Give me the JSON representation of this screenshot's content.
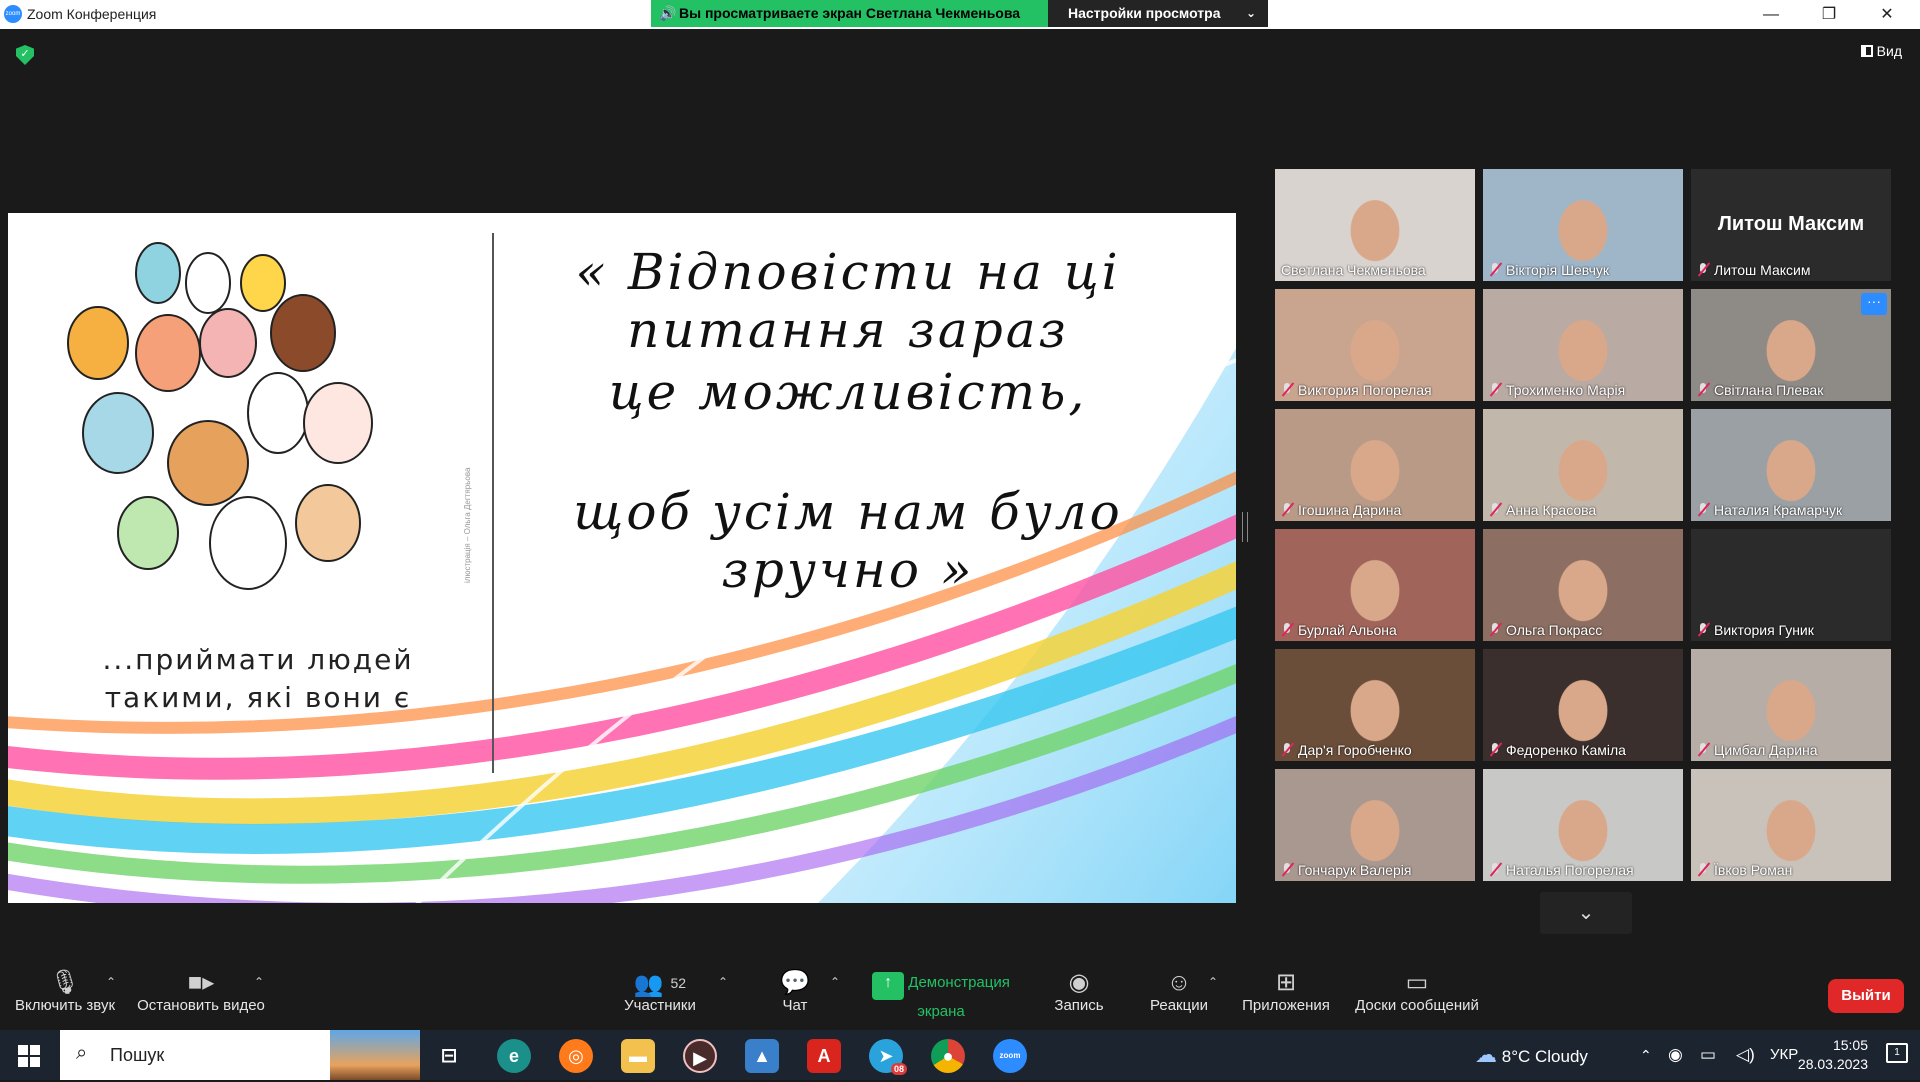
{
  "titlebar": {
    "app_title": "Zoom Конференция",
    "share_banner": "Вы просматриваете экран Светлана Чекменьова",
    "view_settings": "Настройки просмотра",
    "minimize": "—",
    "restore": "❐",
    "close": "✕"
  },
  "main": {
    "view_label": "Вид"
  },
  "slide": {
    "quote_line1": "« Відповісти на ці питання зараз",
    "quote_line2": "це можливість,",
    "quote_line3": "щоб усім нам було зручно »",
    "caption_line1": "...приймати людей",
    "caption_line2": "такими, які вони є",
    "illustrator": "ілюстрація – Ольга Дегтярьова"
  },
  "gallery": {
    "tiles": [
      {
        "name": "Светлана Чекменьова",
        "muted": false,
        "active": true,
        "photo_color": "#d9d3cf"
      },
      {
        "name": "Вікторія Шевчук",
        "muted": true,
        "photo_color": "#9fb6c9"
      },
      {
        "name": "Литош Максим",
        "muted": true,
        "no_video": true,
        "big_name": "Литош Максим"
      },
      {
        "name": "Виктория Погорелая",
        "muted": true,
        "photo_color": "#c9a590"
      },
      {
        "name": "Трохименко Марія",
        "muted": true,
        "photo_color": "#b9aaa3"
      },
      {
        "name": "Світлана Плевак",
        "muted": true,
        "photo_color": "#8e8a86",
        "more": "···"
      },
      {
        "name": "Ігошина Дарина",
        "muted": true,
        "photo_color": "#b89a86"
      },
      {
        "name": "Анна Красова",
        "muted": true,
        "photo_color": "#c2b7ab"
      },
      {
        "name": "Наталия Крамарчук",
        "muted": true,
        "photo_color": "#9aa0a3"
      },
      {
        "name": "Бурлай Альона",
        "muted": true,
        "photo_color": "#a0645a"
      },
      {
        "name": "Ольга Покрасс",
        "muted": true,
        "photo_color": "#8c6e62"
      },
      {
        "name": "Виктория Гуник",
        "muted": true,
        "no_video": true,
        "big_name": ""
      },
      {
        "name": "Дар'я Горобченко",
        "muted": true,
        "photo_color": "#6a4e3a"
      },
      {
        "name": "Федоренко Каміла",
        "muted": true,
        "photo_color": "#3a2f2c"
      },
      {
        "name": "Цимбал Дарина",
        "muted": true,
        "photo_color": "#b5ada6"
      },
      {
        "name": "Гончарук Валерія",
        "muted": true,
        "photo_color": "#a89890"
      },
      {
        "name": "Наталья Погорелая",
        "muted": true,
        "photo_color": "#c8c8c6"
      },
      {
        "name": "Ївков Роман",
        "muted": true,
        "photo_color": "#c8c2bb"
      }
    ],
    "scroll_down": "⌄"
  },
  "toolbar": {
    "unmute": "Включить звук",
    "stop_video": "Остановить видео",
    "participants": "Участники",
    "participants_count": "52",
    "chat": "Чат",
    "share_screen": "Демонстрация экрана",
    "record": "Запись",
    "reactions": "Реакции",
    "apps": "Приложения",
    "whiteboards": "Доски сообщений",
    "leave": "Выйти"
  },
  "taskbar": {
    "search_placeholder": "Пошук",
    "weather": "8°C  Cloudy",
    "lang": "УКР",
    "time": "15:05",
    "date": "28.03.2023",
    "telegram_badge": "08"
  },
  "colors": {
    "accent_green": "#23c064",
    "active_border": "#c8e65a",
    "leave_red": "#e02828",
    "zoom_blue": "#2d8cff"
  }
}
